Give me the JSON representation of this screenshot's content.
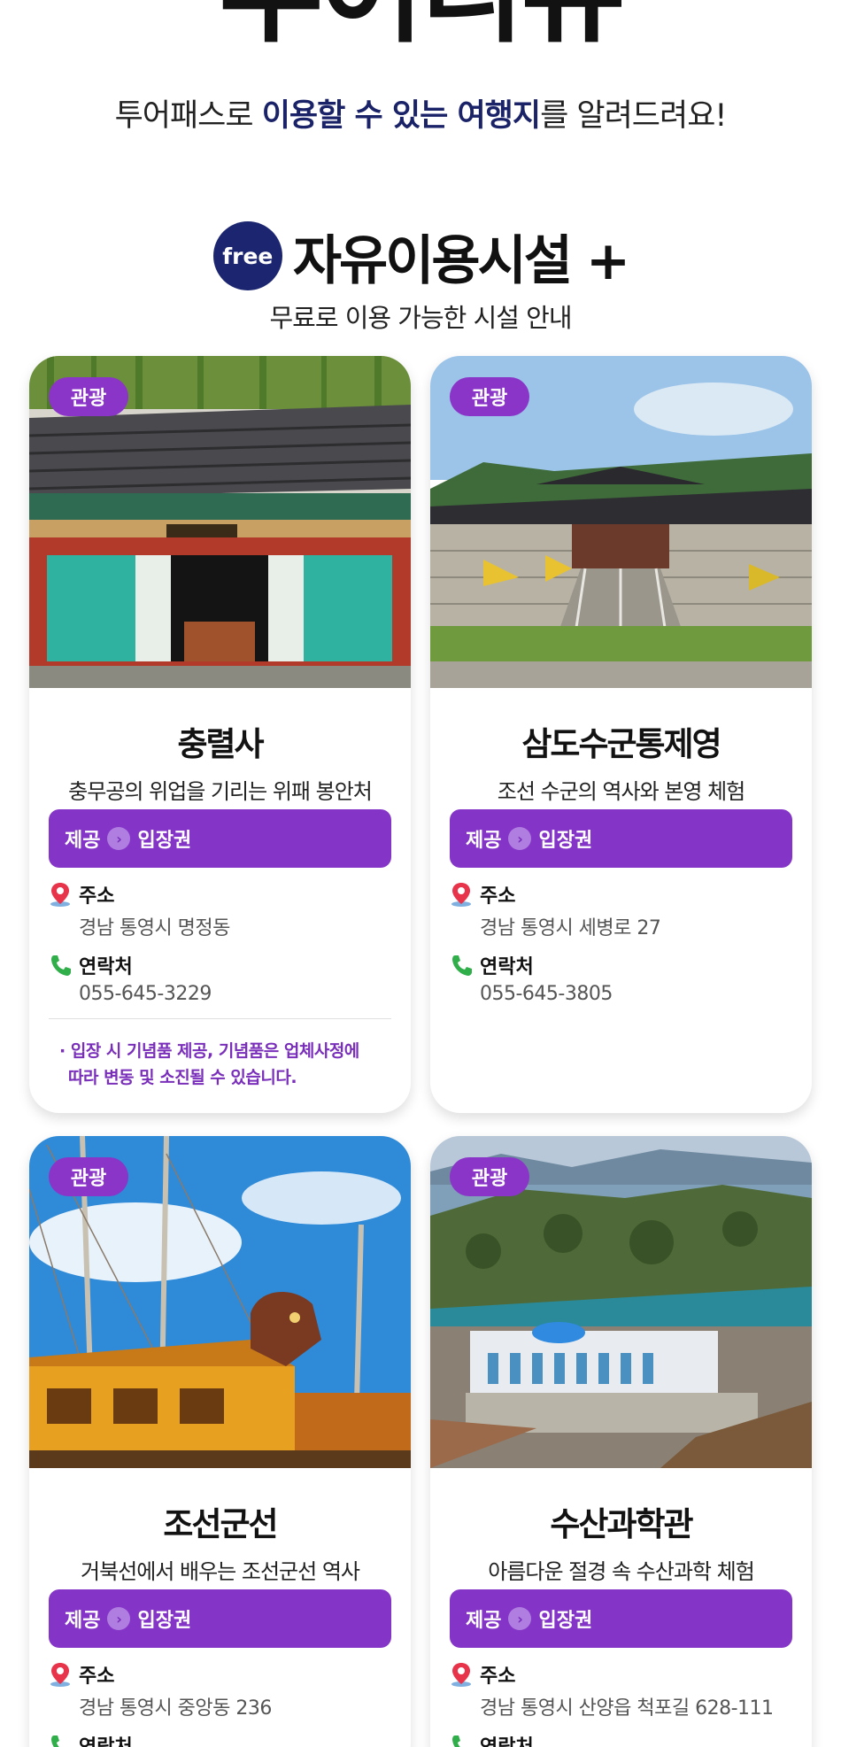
{
  "hero": {
    "title": "투어리뷰",
    "subtitle_pre": "투어패스로 ",
    "subtitle_highlight1": "이용할 수 있는 여행지",
    "subtitle_post": "를 알려드려요!"
  },
  "section": {
    "badge": "free",
    "title": "자유이용시설 +",
    "subtitle": "무료로 이용 가능한 시설 안내"
  },
  "labels": {
    "offer_prefix": "제공",
    "address": "주소",
    "contact": "연락처"
  },
  "cards": [
    {
      "tag": "관광",
      "name": "충렬사",
      "desc": "충무공의 위업을 기리는 위패 봉안처",
      "offer": "입장권",
      "address": "경남 통영시 명정동",
      "phone": "055-645-3229",
      "note_line1": "· 입장 시  기념품 제공, 기념품은 업체사정에",
      "note_line2": "따라 변동 및 소진될 수 있습니다."
    },
    {
      "tag": "관광",
      "name": "삼도수군통제영",
      "desc": "조선 수군의 역사와 본영 체험",
      "offer": "입장권",
      "address": "경남 통영시 세병로 27",
      "phone": "055-645-3805"
    },
    {
      "tag": "관광",
      "name": "조선군선",
      "desc": "거북선에서 배우는 조선군선 역사",
      "offer": "입장권",
      "address": "경남 통영시 중앙동 236",
      "phone": ""
    },
    {
      "tag": "관광",
      "name": "수산과학관",
      "desc": "아름다운 절경 속 수산과학 체험",
      "offer": "입장권",
      "address": "경남 통영시 산양읍 척포길 628-111",
      "phone": ""
    }
  ],
  "colors": {
    "accent_purple": "#8434c6",
    "navy": "#1c2670",
    "pin_red": "#e8344b",
    "phone_green": "#2fae4a"
  }
}
